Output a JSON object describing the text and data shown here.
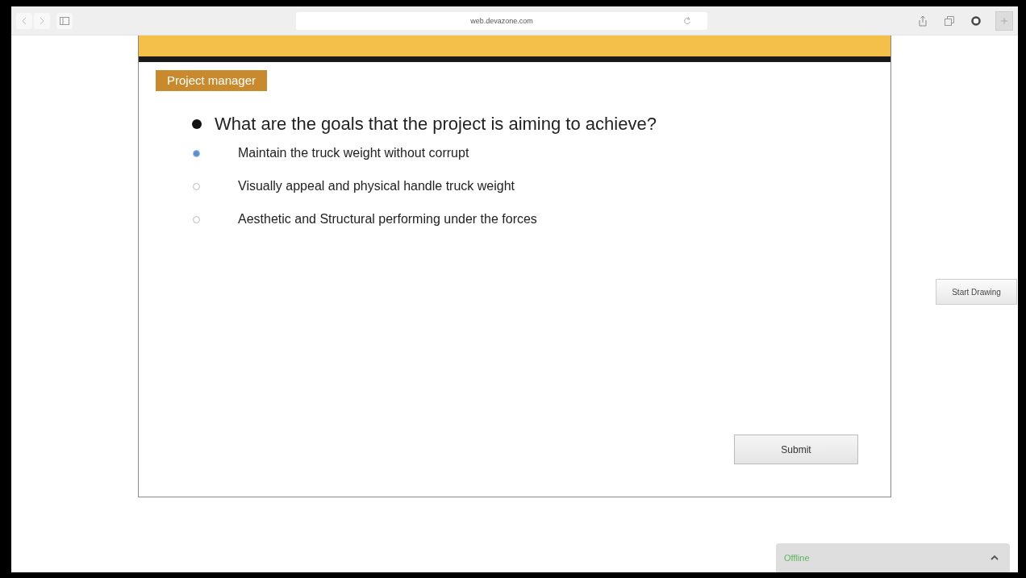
{
  "browser": {
    "url": "web.devazone.com"
  },
  "card": {
    "tag": "Project manager",
    "question": "What are the goals that the project is aiming to achieve?",
    "options": [
      {
        "label": "Maintain the truck weight without corrupt",
        "selected": true
      },
      {
        "label": "Visually appeal and physical handle truck weight",
        "selected": false
      },
      {
        "label": "Aesthetic and Structural performing under the forces",
        "selected": false
      }
    ],
    "submit": "Submit"
  },
  "side_button": "Start Drawing",
  "status_bar": {
    "label": "Offline"
  }
}
